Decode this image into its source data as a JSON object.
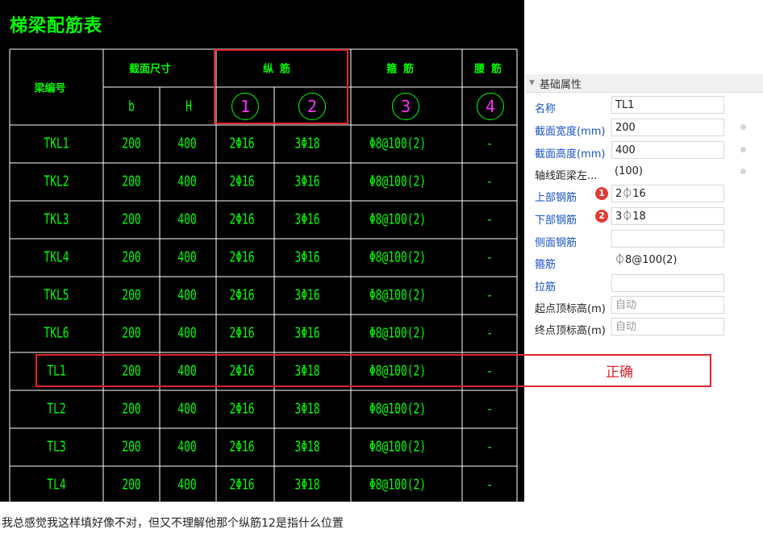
{
  "cad": {
    "title": "梯梁配筋表",
    "headers": {
      "beam_no": "梁编号",
      "section": "截面尺寸",
      "longitudinal": "纵  筋",
      "stirrup": "箍  筋",
      "waist": "腰  筋",
      "b": "b",
      "h": "H",
      "circle_1": "1",
      "circle_2": "2",
      "circle_3": "3",
      "circle_4": "4"
    },
    "rows": [
      [
        "TKL1",
        "200",
        "400",
        "2Φ16",
        "3Φ18",
        "Φ8@100(2)",
        "-"
      ],
      [
        "TKL2",
        "200",
        "400",
        "2Φ16",
        "3Φ16",
        "Φ8@100(2)",
        "-"
      ],
      [
        "TKL3",
        "200",
        "400",
        "2Φ16",
        "3Φ16",
        "Φ8@100(2)",
        "-"
      ],
      [
        "TKL4",
        "200",
        "400",
        "2Φ16",
        "3Φ16",
        "Φ8@100(2)",
        "-"
      ],
      [
        "TKL5",
        "200",
        "400",
        "2Φ16",
        "3Φ16",
        "Φ8@100(2)",
        "-"
      ],
      [
        "TKL6",
        "200",
        "400",
        "2Φ16",
        "3Φ16",
        "Φ8@100(2)",
        "-"
      ],
      [
        "TL1",
        "200",
        "400",
        "2Φ16",
        "3Φ18",
        "Φ8@100(2)",
        "-"
      ],
      [
        "TL2",
        "200",
        "400",
        "2Φ16",
        "3Φ18",
        "Φ8@100(2)",
        "-"
      ],
      [
        "TL3",
        "200",
        "400",
        "2Φ16",
        "3Φ18",
        "Φ8@100(2)",
        "-"
      ],
      [
        "TL4",
        "200",
        "400",
        "2Φ16",
        "3Φ18",
        "Φ8@100(2)",
        "-"
      ]
    ]
  },
  "panel": {
    "header": "基础属性",
    "props": [
      {
        "label": "名称",
        "value": "TL1"
      },
      {
        "label": "截面宽度(mm)",
        "value": "200"
      },
      {
        "label": "截面高度(mm)",
        "value": "400"
      },
      {
        "label": "轴线距梁左...",
        "value": "(100)"
      },
      {
        "label": "上部钢筋",
        "value": "2⏀16",
        "badge": "1"
      },
      {
        "label": "下部钢筋",
        "value": "3⏀18",
        "badge": "2"
      },
      {
        "label": "侧面钢筋",
        "value": ""
      },
      {
        "label": "箍筋",
        "value": "⏀8@100(2)"
      },
      {
        "label": "拉筋",
        "value": ""
      },
      {
        "label": "起点顶标高(m)",
        "value": "自动"
      },
      {
        "label": "终点顶标高(m)",
        "value": "自动"
      }
    ]
  },
  "annotation": {
    "correct": "正确"
  },
  "caption": "我总感觉我这样填好像不对，但又不理解他那个纵筋12是指什么位置"
}
